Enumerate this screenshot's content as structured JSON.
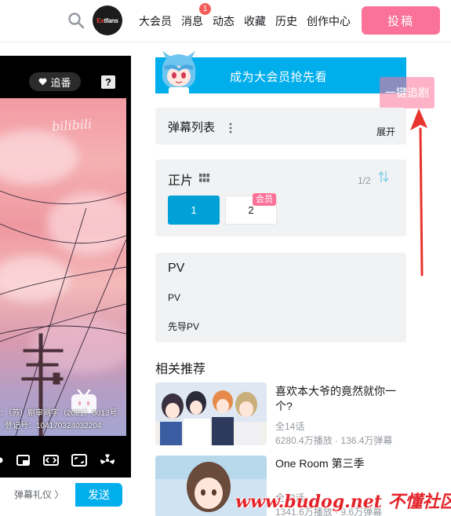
{
  "header": {
    "avatar_text_a": "Ex",
    "avatar_text_b": "tfans",
    "nav": [
      "大会员",
      "消息",
      "动态",
      "收藏",
      "历史",
      "创作中心"
    ],
    "message_badge": "1",
    "post_label": "投稿"
  },
  "player": {
    "follow_label": "追番",
    "help_label": "?",
    "watermark": "bilibili",
    "reg_line_1": "：（苏）剧审网字（2021）0013号",
    "reg_line_2": "登记号：104170324032204"
  },
  "danmaku_bar": {
    "etiquette_label": "弹幕礼仪 〉",
    "send_label": "发送"
  },
  "vip_banner": {
    "text": "成为大会员抢先看"
  },
  "one_click_follow": "一键追剧",
  "danmaku_list": {
    "title": "弹幕列表",
    "expand": "展开"
  },
  "main_episodes": {
    "title": "正片",
    "page": "1/2",
    "episodes": [
      "1",
      "2"
    ],
    "vip_tag": "会员"
  },
  "pv_section": {
    "title": "PV",
    "items": [
      "PV",
      "先导PV"
    ]
  },
  "recommendations": {
    "title": "相关推荐",
    "items": [
      {
        "name": "喜欢本大爷的竟然就你一个?",
        "episodes": "全14话",
        "plays": "6280.4万播放",
        "danmaku": "136.4万弹幕"
      },
      {
        "name": "One Room 第三季",
        "episodes": "全12话",
        "plays": "1341.6万播放",
        "danmaku": "9.6万弹幕"
      }
    ]
  },
  "site_watermark": "www.budog.net 不懂社区",
  "colors": {
    "accent": "#00aeec",
    "pink": "#fb7299",
    "arrow": "#e8352f"
  }
}
